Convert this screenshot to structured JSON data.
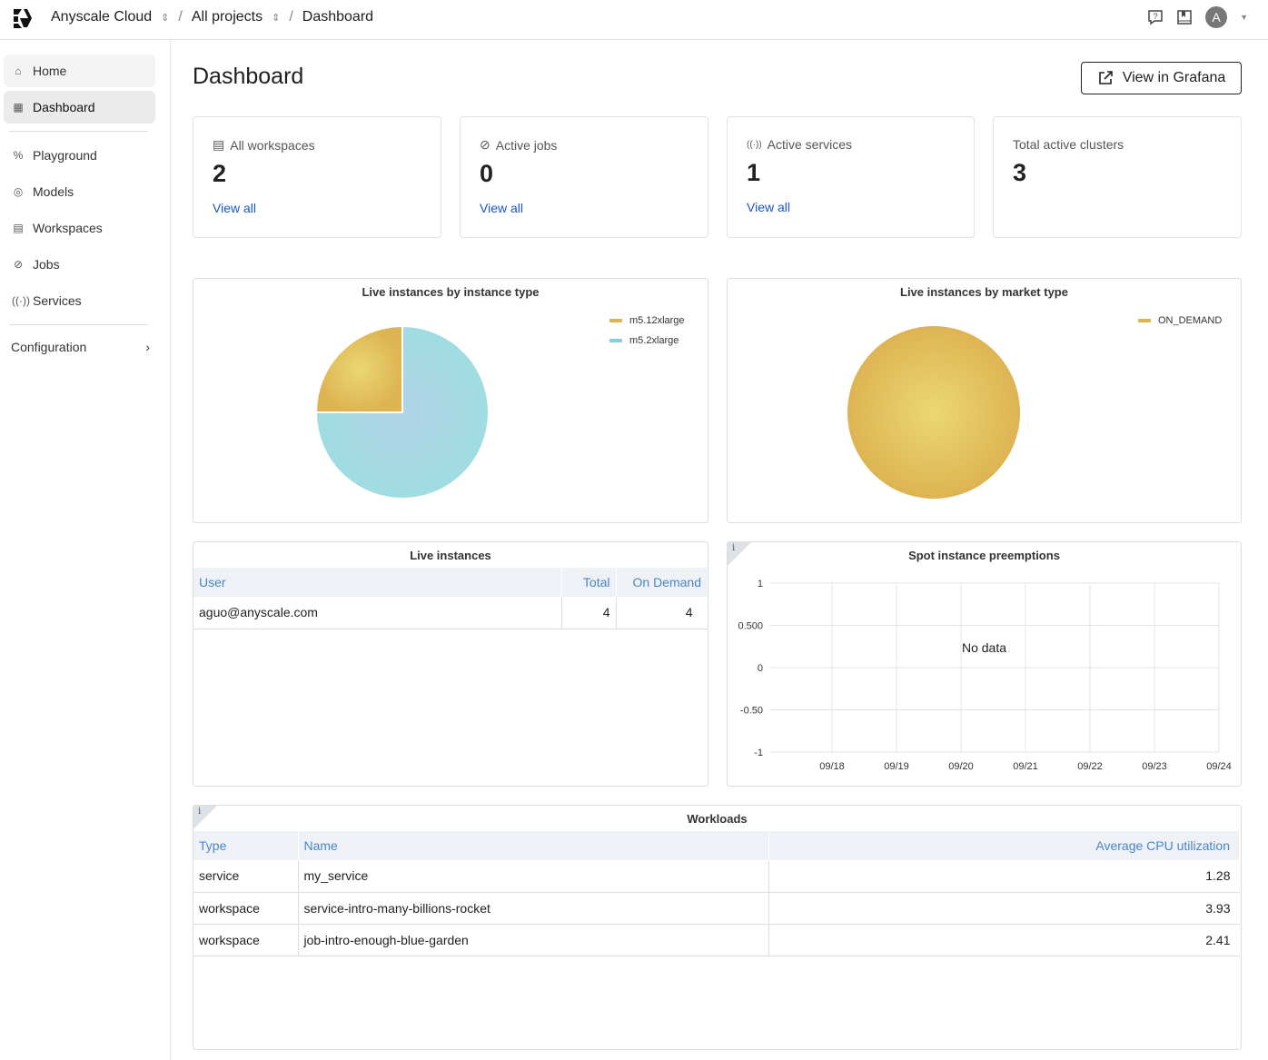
{
  "topbar": {
    "org": "Anyscale Cloud",
    "project": "All projects",
    "page": "Dashboard",
    "avatar": "A"
  },
  "sidebar": {
    "items": [
      {
        "label": "Home",
        "icon": "home-icon"
      },
      {
        "label": "Dashboard",
        "icon": "dashboard-icon"
      },
      {
        "label": "Playground",
        "icon": "playground-icon"
      },
      {
        "label": "Models",
        "icon": "models-icon"
      },
      {
        "label": "Workspaces",
        "icon": "workspaces-icon"
      },
      {
        "label": "Jobs",
        "icon": "jobs-icon"
      },
      {
        "label": "Services",
        "icon": "services-icon"
      }
    ],
    "configuration": "Configuration"
  },
  "main": {
    "title": "Dashboard",
    "grafana_button": "View in Grafana",
    "cards": [
      {
        "label": "All workspaces",
        "value": "2",
        "link": "View all"
      },
      {
        "label": "Active jobs",
        "value": "0",
        "link": "View all"
      },
      {
        "label": "Active services",
        "value": "1",
        "link": "View all"
      },
      {
        "label": "Total active clusters",
        "value": "3"
      }
    ]
  },
  "chart_data": [
    {
      "type": "pie",
      "title": "Live instances by instance type",
      "labels": [
        "m5.12xlarge",
        "m5.2xlarge"
      ],
      "values": [
        1,
        3
      ],
      "colors": [
        "#deb453",
        "#9fd8e0"
      ],
      "legend": "top-right"
    },
    {
      "type": "pie",
      "title": "Live instances by market type",
      "labels": [
        "ON_DEMAND"
      ],
      "values": [
        1
      ],
      "colors": [
        "#deb453"
      ],
      "legend": "top-right"
    },
    {
      "type": "line",
      "title": "Spot instance preemptions",
      "message": "No data",
      "yticks": [
        "1",
        "0.500",
        "0",
        "-0.50",
        "-1"
      ],
      "xticks": [
        "09/18",
        "09/19",
        "09/20",
        "09/21",
        "09/22",
        "09/23",
        "09/24"
      ],
      "ylim": [
        -1,
        1
      ],
      "grid": true
    }
  ],
  "live_instances": {
    "title": "Live instances",
    "columns": [
      "User",
      "Total",
      "On Demand"
    ],
    "rows": [
      [
        "aguo@anyscale.com",
        "4",
        "4"
      ]
    ]
  },
  "workloads": {
    "title": "Workloads",
    "columns": [
      "Type",
      "Name",
      "Average CPU utilization"
    ],
    "rows": [
      [
        "service",
        "my_service",
        "1.28"
      ],
      [
        "workspace",
        "service-intro-many-billions-rocket",
        "3.93"
      ],
      [
        "workspace",
        "job-intro-enough-blue-garden",
        "2.41"
      ]
    ]
  }
}
